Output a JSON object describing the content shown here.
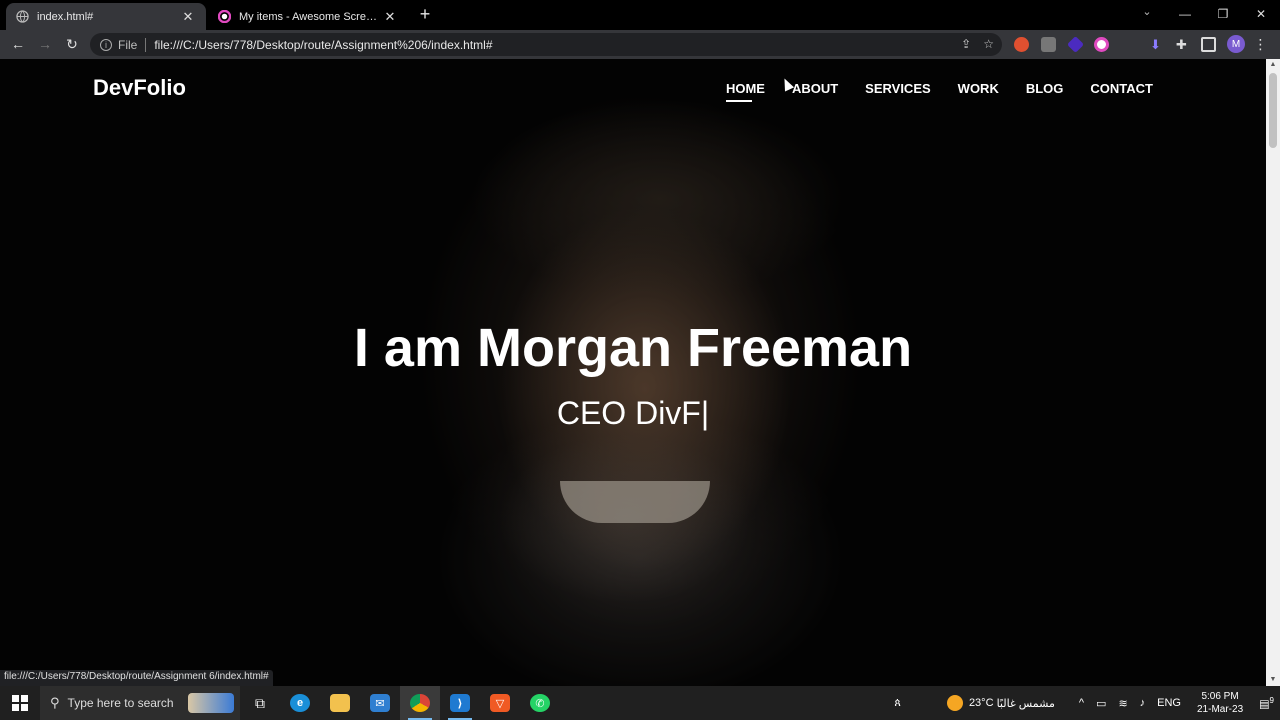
{
  "browser": {
    "tabs": [
      {
        "title": "index.html#",
        "active": true
      },
      {
        "title": "My items - Awesome Screenshot",
        "active": false
      }
    ],
    "new_tab": "+",
    "window_controls": {
      "minimize": "—",
      "maximize": "❐",
      "close": "✕"
    },
    "tab_search": "⌄",
    "omnibox": {
      "scheme_label": "File",
      "url": "file:///C:/Users/778/Desktop/route/Assignment%206/index.html#"
    },
    "avatar_initial": "M",
    "status_url": "file:///C:/Users/778/Desktop/route/Assignment 6/index.html#"
  },
  "site": {
    "brand": "DevFolio",
    "nav": [
      {
        "label": "HOME",
        "current": true
      },
      {
        "label": "ABOUT",
        "current": false
      },
      {
        "label": "SERVICES",
        "current": false
      },
      {
        "label": "WORK",
        "current": false
      },
      {
        "label": "BLOG",
        "current": false
      },
      {
        "label": "CONTACT",
        "current": false
      }
    ],
    "hero": {
      "title": "I am Morgan Freeman",
      "subtitle": "CEO DivF|"
    }
  },
  "taskbar": {
    "search_placeholder": "Type here to search",
    "weather": {
      "temp": "23°C",
      "text": "مشمس غالبًا"
    },
    "language": "ENG",
    "time": "5:06 PM",
    "date": "21-Mar-23",
    "notifications": "9"
  },
  "colors": {
    "tab_bar": "#000000",
    "toolbar": "#35363a",
    "omnibox": "#202124",
    "taskbar": "#202020",
    "accent": "#76b9ed"
  }
}
